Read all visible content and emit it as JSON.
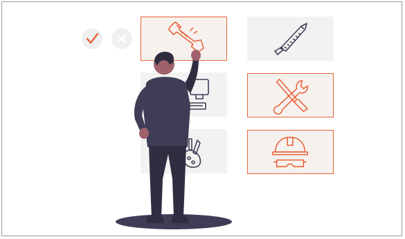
{
  "scene": {
    "accent_color": "#e8623a",
    "ink_color": "#3f3d56",
    "tiles": [
      {
        "icon": "bolt-wrench-icon",
        "selected": true
      },
      {
        "icon": "saw-icon",
        "selected": false
      },
      {
        "icon": "computer-icon",
        "selected": false
      },
      {
        "icon": "wrench-screwdriver-icon",
        "selected": true
      },
      {
        "icon": "art-tools-icon",
        "selected": false
      },
      {
        "icon": "hard-hat-goggles-icon",
        "selected": true
      }
    ],
    "choice_marks": [
      "check-icon",
      "close-icon"
    ]
  }
}
